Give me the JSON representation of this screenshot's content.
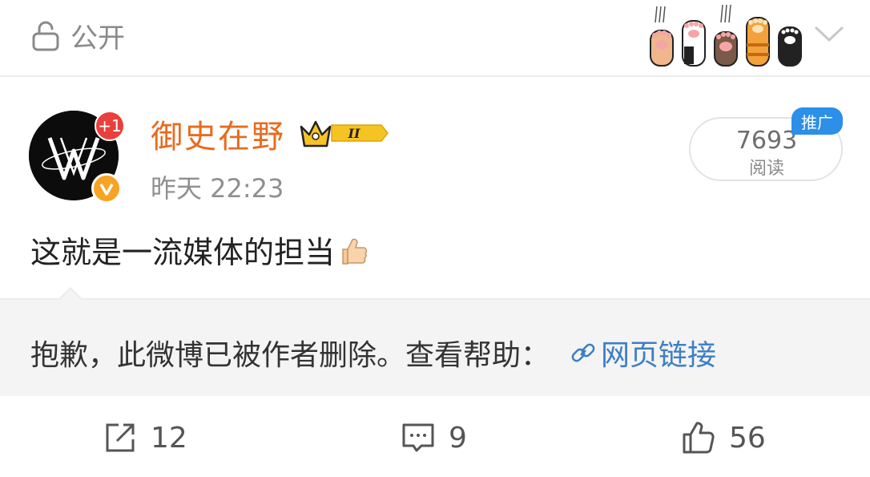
{
  "header": {
    "visibility_label": "公开",
    "lock_icon": "lock-icon",
    "decor_icon": "cat-paws-icon",
    "menu_icon": "chevron-down-icon"
  },
  "post": {
    "author": {
      "name": "御史在野",
      "avatar_badge": "+1",
      "verified_icon": "verified-v-icon",
      "level_badge": "II"
    },
    "timestamp": "昨天 22:23",
    "read_count": "7693",
    "read_label": "阅读",
    "promo_tag": "推广",
    "text": "这就是一流媒体的担当",
    "emoji": "thumbs-up"
  },
  "deleted_notice": {
    "message": "抱歉，此微博已被作者删除。查看帮助：",
    "link_label": "网页链接"
  },
  "actions": {
    "repost_count": "12",
    "comment_count": "9",
    "like_count": "56"
  },
  "colors": {
    "username": "#e86b1e",
    "link": "#3d7ec4",
    "promo": "#2c8fe8",
    "badge_red": "#e8403c",
    "verified": "#f7a324"
  }
}
